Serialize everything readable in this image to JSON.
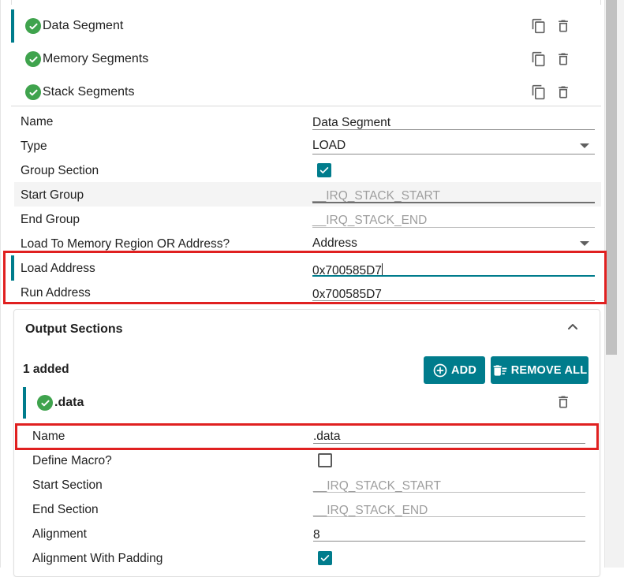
{
  "segments": [
    {
      "label": "Data Segment",
      "selected": true
    },
    {
      "label": "Memory Segments",
      "selected": false
    },
    {
      "label": "Stack Segments",
      "selected": false
    }
  ],
  "form": {
    "name": {
      "label": "Name",
      "value": "Data Segment"
    },
    "type": {
      "label": "Type",
      "value": "LOAD"
    },
    "group_section": {
      "label": "Group Section",
      "checked": true
    },
    "start_group": {
      "label": "Start Group",
      "placeholder": "__IRQ_STACK_START"
    },
    "end_group": {
      "label": "End Group",
      "placeholder": "__IRQ_STACK_END"
    },
    "load_to": {
      "label": "Load To Memory Region OR Address?",
      "value": "Address"
    },
    "load_address": {
      "label": "Load Address",
      "value": "0x700585D7"
    },
    "run_address": {
      "label": "Run Address",
      "value": "0x700585D7"
    }
  },
  "output_sections": {
    "title": "Output Sections",
    "count_label": "1 added",
    "add_label": "ADD",
    "remove_all_label": "REMOVE ALL",
    "item": {
      "label": ".data",
      "name": {
        "label": "Name",
        "value": ".data"
      },
      "define_macro": {
        "label": "Define Macro?",
        "checked": false
      },
      "start_section": {
        "label": "Start Section",
        "placeholder": "__IRQ_STACK_START"
      },
      "end_section": {
        "label": "End Section",
        "placeholder": "__IRQ_STACK_END"
      },
      "alignment": {
        "label": "Alignment",
        "value": "8"
      },
      "alignment_padding": {
        "label": "Alignment With Padding",
        "checked": true
      }
    }
  },
  "colors": {
    "accent": "#007c8c",
    "success": "#3fa34d",
    "highlight": "#e02020"
  }
}
